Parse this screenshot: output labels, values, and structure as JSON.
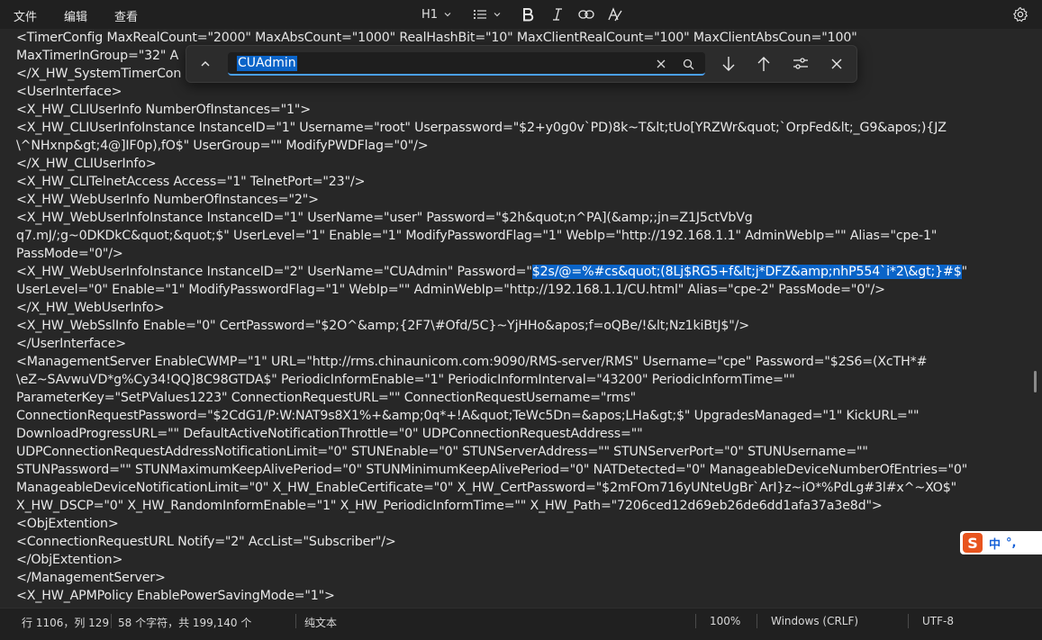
{
  "menu": {
    "file": "文件",
    "edit": "编辑",
    "view": "查看"
  },
  "toolbar": {
    "heading": "H1",
    "icons": [
      "chevron-down-icon",
      "list-icon",
      "bold-icon",
      "italic-icon",
      "link-icon",
      "clear-format-icon",
      "settings-icon"
    ]
  },
  "find": {
    "query": "CUAdmin",
    "icons": [
      "collapse-chevron-icon",
      "clear-icon",
      "search-icon",
      "next-match-icon",
      "previous-match-icon",
      "find-options-icon",
      "close-icon"
    ]
  },
  "editor": {
    "lines": [
      {
        "text": "<TimerConfig MaxRealCount=\"2000\" MaxAbsCount=\"1000\" RealHashBit=\"10\" MaxClientRealCount=\"100\" MaxClientAbsCoun=\"100\""
      },
      {
        "text": "MaxTimerInGroup=\"32\" A"
      },
      {
        "text": "</X_HW_SystemTimerCon"
      },
      {
        "text": "<UserInterface>"
      },
      {
        "text": "<X_HW_CLIUserInfo NumberOfInstances=\"1\">"
      },
      {
        "text": "<X_HW_CLIUserInfoInstance InstanceID=\"1\" Username=\"root\" Userpassword=\"$2+y0g0v`PD)8k~T&lt;tUo[YRZWr&quot;`OrpFed&lt;_G9&apos;){JZ"
      },
      {
        "text": "\\^NHxnp&gt;4@]IF0p),fO$\" UserGroup=\"\" ModifyPWDFlag=\"0\"/>"
      },
      {
        "text": "</X_HW_CLIUserInfo>"
      },
      {
        "text": "<X_HW_CLITelnetAccess Access=\"1\" TelnetPort=\"23\"/>"
      },
      {
        "text": "<X_HW_WebUserInfo NumberOfInstances=\"2\">"
      },
      {
        "text": "<X_HW_WebUserInfoInstance InstanceID=\"1\" UserName=\"user\" Password=\"$2h&quot;n^PA](&amp;;jn=Z1J5ctVbVg"
      },
      {
        "text": "q7.mJ/;g~0DKDkC&quot;&quot;$\" UserLevel=\"1\" Enable=\"1\" ModifyPasswordFlag=\"1\" WebIp=\"http://192.168.1.1\" AdminWebIp=\"\" Alias=\"cpe-1\""
      },
      {
        "text": "PassMode=\"0\"/>"
      },
      {
        "text": "<X_HW_WebUserInfoInstance InstanceID=\"2\" UserName=\"CUAdmin\" Password=\"",
        "highlight": "$2s/@=%#cs&quot;(8Lj$RG5+f&lt;j*DFZ&amp;nhP554`i*2\\&gt;}#$",
        "after": "\""
      },
      {
        "text": "UserLevel=\"0\" Enable=\"1\" ModifyPasswordFlag=\"1\" WebIp=\"\" AdminWebIp=\"http://192.168.1.1/CU.html\" Alias=\"cpe-2\" PassMode=\"0\"/>"
      },
      {
        "text": "</X_HW_WebUserInfo>"
      },
      {
        "text": "<X_HW_WebSslInfo Enable=\"0\" CertPassword=\"$2O^&amp;{2F7\\#Ofd/5C}~YjHHo&apos;f=oQBe/!&lt;Nz1kiBtJ$\"/>"
      },
      {
        "text": "</UserInterface>"
      },
      {
        "text": "<ManagementServer EnableCWMP=\"1\" URL=\"http://rms.chinaunicom.com:9090/RMS-server/RMS\" Username=\"cpe\" Password=\"$2S6=(XcTH*#"
      },
      {
        "text": "\\eZ~SAvwuVD*g%Cy34!QQ]8C98GTDA$\" PeriodicInformEnable=\"1\" PeriodicInformInterval=\"43200\" PeriodicInformTime=\"\""
      },
      {
        "text": "ParameterKey=\"SetPValues1223\" ConnectionRequestURL=\"\" ConnectionRequestUsername=\"rms\""
      },
      {
        "text": "ConnectionRequestPassword=\"$2CdG1/P:W:NAT9s8X1%+&amp;0q*+!A&quot;TeWc5Dn=&apos;LHa&gt;$\" UpgradesManaged=\"1\" KickURL=\"\""
      },
      {
        "text": "DownloadProgressURL=\"\" DefaultActiveNotificationThrottle=\"0\" UDPConnectionRequestAddress=\"\""
      },
      {
        "text": "UDPConnectionRequestAddressNotificationLimit=\"0\" STUNEnable=\"0\" STUNServerAddress=\"\" STUNServerPort=\"0\" STUNUsername=\"\""
      },
      {
        "text": "STUNPassword=\"\" STUNMaximumKeepAlivePeriod=\"0\" STUNMinimumKeepAlivePeriod=\"0\" NATDetected=\"0\" ManageableDeviceNumberOfEntries=\"0\""
      },
      {
        "text": "ManageableDeviceNotificationLimit=\"0\" X_HW_EnableCertificate=\"0\" X_HW_CertPassword=\"$2mFOm716yUNteUgBr`ArI}z~iO*%PdLg#3l#x^~XO$\""
      },
      {
        "text": "X_HW_DSCP=\"0\" X_HW_RandomInformEnable=\"1\" X_HW_PeriodicInformTime=\"\" X_HW_Path=\"7206ced12d69eb26de6dd1afa37a3e8d\">"
      },
      {
        "text": "<ObjExtention>"
      },
      {
        "text": "<ConnectionRequestURL Notify=\"2\" AccList=\"Subscriber\"/>"
      },
      {
        "text": "</ObjExtention>"
      },
      {
        "text": "</ManagementServer>"
      },
      {
        "text": "<X_HW_APMPolicy EnablePowerSavingMode=\"1\">"
      }
    ]
  },
  "ime": {
    "logo": "S",
    "mode": "中",
    "punct": "°,"
  },
  "status": {
    "position": "行 1106，列 129",
    "counts": "58 个字符，共 199,140 个",
    "format": "纯文本",
    "zoom": "100%",
    "line_ending": "Windows (CRLF)",
    "encoding": "UTF-8"
  },
  "colors": {
    "highlight": "#0a64c8",
    "background": "#272727",
    "accent": "#4aa0f0"
  }
}
